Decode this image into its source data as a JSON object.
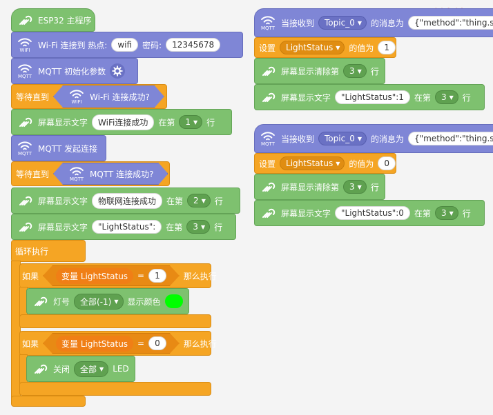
{
  "watermark": "DF创客社区",
  "colors": {
    "green": "#7ec16f",
    "blue": "#7f86d6",
    "orange": "#f5a524",
    "led_color": "#00ff00"
  },
  "main": {
    "esp32": "ESP32 主程序",
    "wifi_connect": {
      "label": "Wi-Fi 连接到 热点:",
      "ssid": "wifi",
      "pwd_label": "密码:",
      "pwd": "12345678"
    },
    "mqtt_init": "MQTT 初始化参数",
    "wait1": {
      "label": "等待直到",
      "cond": "Wi-Fi 连接成功?"
    },
    "show1": {
      "label": "屏幕显示文字",
      "text": "WiFi连接成功",
      "at": "在第",
      "line": "1",
      "unit": "行"
    },
    "mqtt_connect": "MQTT 发起连接",
    "wait2": {
      "label": "等待直到",
      "cond": "MQTT 连接成功?"
    },
    "show2": {
      "label": "屏幕显示文字",
      "text": "物联网连接成功",
      "at": "在第",
      "line": "2",
      "unit": "行"
    },
    "show3": {
      "label": "屏幕显示文字",
      "text": "\"LightStatus\": ",
      "at": "在第",
      "line": "3",
      "unit": "行"
    },
    "loop": "循环执行",
    "if1": {
      "if": "如果",
      "var_label": "变量",
      "var": "LightStatus",
      "eq": "=",
      "val": "1",
      "then": "那么执行"
    },
    "lamp": {
      "label": "灯号",
      "which": "全部(-1)",
      "show": "显示颜色"
    },
    "if2": {
      "if": "如果",
      "var_label": "变量",
      "var": "LightStatus",
      "eq": "=",
      "val": "0",
      "then": "那么执行"
    },
    "off": {
      "label": "关闭",
      "which": "全部",
      "suffix": "LED"
    }
  },
  "handler1": {
    "recv": "当接收到",
    "topic": "Topic_0",
    "msg": "的消息为",
    "payload": "{\"method\":\"thing.s",
    "set": "设置",
    "var": "LightStatus",
    "value_label": "的值为",
    "value": "1",
    "clear": "屏幕显示清除第",
    "clear_line": "3",
    "unit": "行",
    "show": "屏幕显示文字",
    "text": "\"LightStatus\":1",
    "at": "在第",
    "line": "3"
  },
  "handler2": {
    "recv": "当接收到",
    "topic": "Topic_0",
    "msg": "的消息为",
    "payload": "{\"method\":\"thing.s",
    "set": "设置",
    "var": "LightStatus",
    "value_label": "的值为",
    "value": "0",
    "clear": "屏幕显示清除第",
    "clear_line": "3",
    "unit": "行",
    "show": "屏幕显示文字",
    "text": "\"LightStatus\":0",
    "at": "在第",
    "line": "3"
  },
  "icons": {
    "mqtt": "MQTT",
    "wifi": "WIFI"
  }
}
